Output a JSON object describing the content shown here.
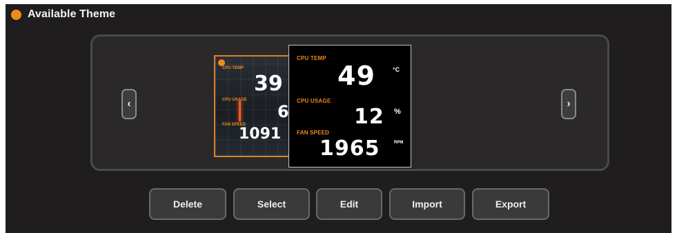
{
  "header": {
    "title": "Available Theme",
    "dot_color": "#f08a1c"
  },
  "carousel": {
    "prev_icon": "chevron-left-icon",
    "prev_glyph": "‹",
    "next_icon": "chevron-right-icon",
    "next_glyph": "›",
    "back_theme": {
      "cpu_temp_label": "CPU TEMP",
      "cpu_temp_value": "39",
      "cpu_usage_label": "CPU USAGE",
      "cpu_usage_value": "6",
      "fan_speed_label": "FAN SPEED",
      "fan_speed_value": "1091"
    },
    "front_theme": {
      "cpu_temp_label": "CPU TEMP",
      "cpu_temp_value": "49",
      "cpu_temp_unit": "°C",
      "cpu_usage_label": "CPU USAGE",
      "cpu_usage_value": "12",
      "cpu_usage_unit": "%",
      "fan_speed_label": "FAN SPEED",
      "fan_speed_value": "1965",
      "fan_speed_unit": "RPM"
    }
  },
  "buttons": {
    "delete": "Delete",
    "select": "Select",
    "edit": "Edit",
    "import": "Import",
    "export": "Export"
  },
  "colors": {
    "accent": "#f08a1c",
    "panel": "#1f1d1e",
    "card_back": "#000000"
  }
}
